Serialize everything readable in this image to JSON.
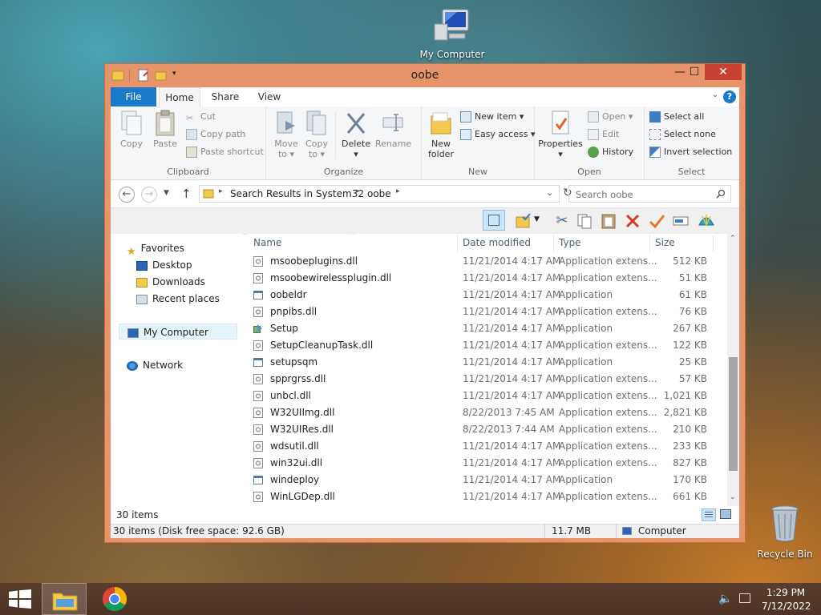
{
  "desktop": {
    "icons": [
      {
        "label": "My Computer"
      },
      {
        "label": "Recycle Bin"
      }
    ]
  },
  "window": {
    "title": "oobe",
    "caption_buttons": {
      "minimize": "—",
      "maximize": "☐",
      "close": "✕"
    },
    "ribbon_tabs": [
      "File",
      "Home",
      "Share",
      "View"
    ],
    "ribbon": {
      "clipboard": {
        "label": "Clipboard",
        "copy": "Copy",
        "paste": "Paste",
        "cut": "Cut",
        "copy_path": "Copy path",
        "paste_shortcut": "Paste shortcut"
      },
      "organize": {
        "label": "Organize",
        "move_to": "Move",
        "move_to_2": "to",
        "copy_to": "Copy",
        "copy_to_2": "to",
        "delete": "Delete",
        "rename": "Rename"
      },
      "new": {
        "label": "New",
        "new_folder": "New",
        "new_folder_2": "folder",
        "new_item": "New item",
        "easy_access": "Easy access"
      },
      "open": {
        "label": "Open",
        "properties": "Properties",
        "open": "Open",
        "edit": "Edit",
        "history": "History"
      },
      "select": {
        "label": "Select",
        "select_all": "Select all",
        "select_none": "Select none",
        "invert_selection": "Invert selection"
      }
    },
    "address": {
      "crumbs": [
        "Search Results in System32",
        "oobe"
      ],
      "search_placeholder": "Search oobe"
    },
    "nav_pane": {
      "favorites": "Favorites",
      "desktop": "Desktop",
      "downloads": "Downloads",
      "recent_places": "Recent places",
      "my_computer": "My Computer",
      "network": "Network"
    },
    "columns": {
      "name": "Name",
      "date": "Date modified",
      "type": "Type",
      "size": "Size"
    },
    "files": [
      {
        "name": "msoobeplugins.dll",
        "date": "11/21/2014 4:17 AM",
        "type": "Application extens...",
        "size": "512 KB",
        "kind": "dll"
      },
      {
        "name": "msoobewirelessplugin.dll",
        "date": "11/21/2014 4:17 AM",
        "type": "Application extens...",
        "size": "51 KB",
        "kind": "dll"
      },
      {
        "name": "oobeldr",
        "date": "11/21/2014 4:17 AM",
        "type": "Application",
        "size": "61 KB",
        "kind": "exe"
      },
      {
        "name": "pnpibs.dll",
        "date": "11/21/2014 4:17 AM",
        "type": "Application extens...",
        "size": "76 KB",
        "kind": "dll"
      },
      {
        "name": "Setup",
        "date": "11/21/2014 4:17 AM",
        "type": "Application",
        "size": "267 KB",
        "kind": "setup"
      },
      {
        "name": "SetupCleanupTask.dll",
        "date": "11/21/2014 4:17 AM",
        "type": "Application extens...",
        "size": "122 KB",
        "kind": "dll"
      },
      {
        "name": "setupsqm",
        "date": "11/21/2014 4:17 AM",
        "type": "Application",
        "size": "25 KB",
        "kind": "exe"
      },
      {
        "name": "spprgrss.dll",
        "date": "11/21/2014 4:17 AM",
        "type": "Application extens...",
        "size": "57 KB",
        "kind": "dll"
      },
      {
        "name": "unbcl.dll",
        "date": "11/21/2014 4:17 AM",
        "type": "Application extens...",
        "size": "1,021 KB",
        "kind": "dll"
      },
      {
        "name": "W32UIImg.dll",
        "date": "8/22/2013 7:45 AM",
        "type": "Application extens...",
        "size": "2,821 KB",
        "kind": "dll"
      },
      {
        "name": "W32UIRes.dll",
        "date": "8/22/2013 7:44 AM",
        "type": "Application extens...",
        "size": "210 KB",
        "kind": "dll"
      },
      {
        "name": "wdsutil.dll",
        "date": "11/21/2014 4:17 AM",
        "type": "Application extens...",
        "size": "233 KB",
        "kind": "dll"
      },
      {
        "name": "win32ui.dll",
        "date": "11/21/2014 4:17 AM",
        "type": "Application extens...",
        "size": "827 KB",
        "kind": "dll"
      },
      {
        "name": "windeploy",
        "date": "11/21/2014 4:17 AM",
        "type": "Application",
        "size": "170 KB",
        "kind": "exe"
      },
      {
        "name": "WinLGDep.dll",
        "date": "11/21/2014 4:17 AM",
        "type": "Application extens...",
        "size": "661 KB",
        "kind": "dll"
      }
    ],
    "item_count": "30 items",
    "status": {
      "left": "30 items (Disk free space: 92.6 GB)",
      "size": "11.7 MB",
      "location": "Computer"
    }
  },
  "taskbar": {
    "time": "1:29 PM",
    "date": "7/12/2022"
  },
  "colors": {
    "window_frame": "#e8946a",
    "file_tab": "#1979ca",
    "close_button": "#c74032",
    "selection": "#e5f3fb"
  }
}
